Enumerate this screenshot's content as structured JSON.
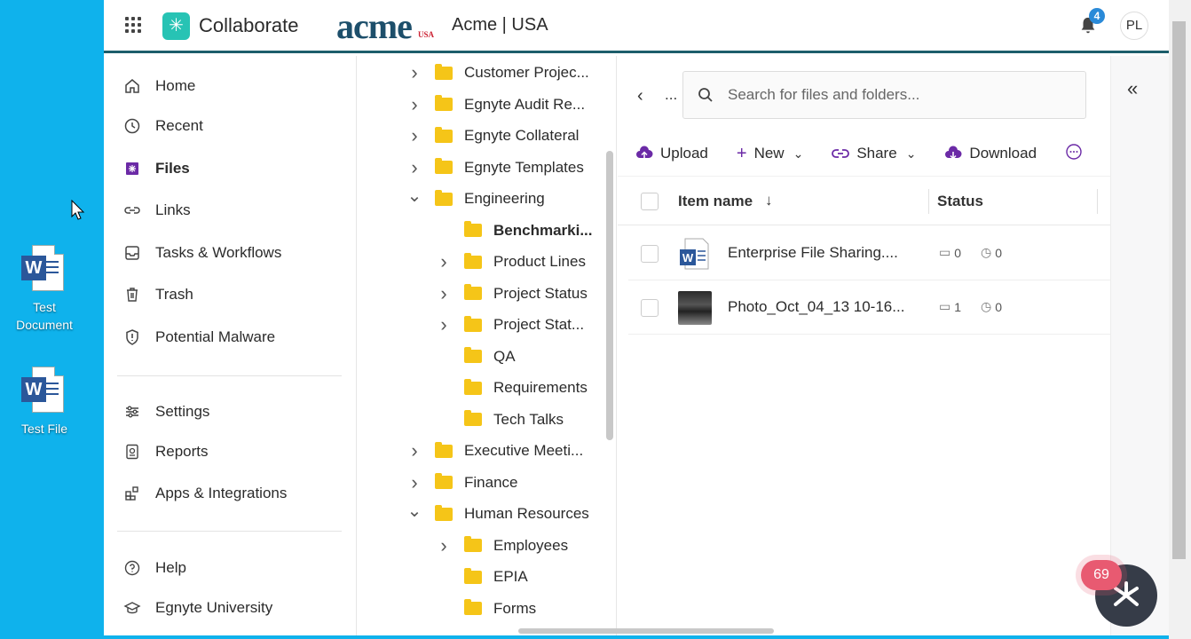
{
  "desktop": {
    "icons": [
      {
        "label_line1": "Test",
        "label_line2": "Document"
      },
      {
        "label_line1": "Test File",
        "label_line2": ""
      }
    ]
  },
  "header": {
    "app_name": "Collaborate",
    "brand_logo_text": "acme",
    "brand_logo_sub": "USA",
    "company": "Acme | USA",
    "notification_count": "4",
    "avatar_initials": "PL"
  },
  "nav": {
    "items": [
      {
        "label": "Home",
        "icon": "home-icon"
      },
      {
        "label": "Recent",
        "icon": "clock-icon"
      },
      {
        "label": "Files",
        "icon": "files-icon",
        "active": true
      },
      {
        "label": "Links",
        "icon": "link-icon"
      },
      {
        "label": "Tasks & Workflows",
        "icon": "tasks-icon"
      },
      {
        "label": "Trash",
        "icon": "trash-icon"
      },
      {
        "label": "Potential Malware",
        "icon": "shield-icon"
      }
    ],
    "items2": [
      {
        "label": "Settings",
        "icon": "sliders-icon"
      },
      {
        "label": "Reports",
        "icon": "reports-icon"
      },
      {
        "label": "Apps & Integrations",
        "icon": "apps-icon"
      }
    ],
    "items3": [
      {
        "label": "Help",
        "icon": "help-icon"
      },
      {
        "label": "Egnyte University",
        "icon": "graduation-cap-icon"
      }
    ]
  },
  "tree": {
    "rows": [
      {
        "label": "Customer Projec...",
        "chevron": "right",
        "level": 0
      },
      {
        "label": "Egnyte Audit Re...",
        "chevron": "right",
        "level": 0
      },
      {
        "label": "Egnyte Collateral",
        "chevron": "right",
        "level": 0
      },
      {
        "label": "Egnyte Templates",
        "chevron": "right",
        "level": 0
      },
      {
        "label": "Engineering",
        "chevron": "down",
        "level": 0
      },
      {
        "label": "Benchmarki...",
        "chevron": "none",
        "level": 1,
        "bold": true
      },
      {
        "label": "Product Lines",
        "chevron": "right",
        "level": 1
      },
      {
        "label": "Project Status",
        "chevron": "right",
        "level": 1
      },
      {
        "label": "Project Stat...",
        "chevron": "right",
        "level": 1
      },
      {
        "label": "QA",
        "chevron": "none",
        "level": 1
      },
      {
        "label": "Requirements",
        "chevron": "none",
        "level": 1
      },
      {
        "label": "Tech Talks",
        "chevron": "none",
        "level": 1
      },
      {
        "label": "Executive Meeti...",
        "chevron": "right",
        "level": 0
      },
      {
        "label": "Finance",
        "chevron": "right",
        "level": 0
      },
      {
        "label": "Human Resources",
        "chevron": "down",
        "level": 0
      },
      {
        "label": "Employees",
        "chevron": "right",
        "level": 1
      },
      {
        "label": "EPIA",
        "chevron": "none",
        "level": 1
      },
      {
        "label": "Forms",
        "chevron": "none",
        "level": 1
      }
    ]
  },
  "main": {
    "breadcrumb_ellipsis": "...",
    "search_placeholder": "Search for files and folders...",
    "toolbar": {
      "upload": "Upload",
      "new": "New",
      "share": "Share",
      "download": "Download"
    },
    "columns": {
      "name": "Item name",
      "status": "Status"
    },
    "files": [
      {
        "name": "Enterprise File Sharing....",
        "comments": "0",
        "versions": "0",
        "type": "word"
      },
      {
        "name": "Photo_Oct_04_13 10-16...",
        "comments": "1",
        "versions": "0",
        "type": "photo"
      }
    ]
  },
  "chat": {
    "unread": "69"
  },
  "colors": {
    "desktop_bg": "#0fb2ec",
    "header_rule": "#1d5e6b",
    "accent_purple": "#6b2aa6",
    "folder": "#f5c518",
    "chat_badge": "#e85a71"
  }
}
